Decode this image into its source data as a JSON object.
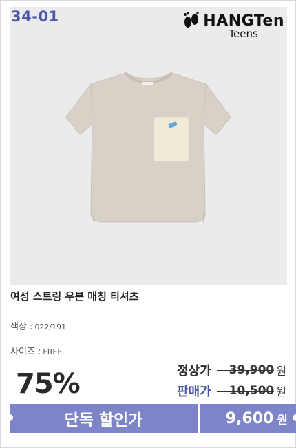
{
  "product": {
    "code": "34-01",
    "brand_name": "HANGTen",
    "brand_sub": "Teens",
    "title": "여성 스트링 우븐 매칭 티셔츠",
    "color_label": "색상 :",
    "color_value": "022/191",
    "size_label": "사이즈 :",
    "size_value": "FREE."
  },
  "pricing": {
    "discount": "75%",
    "regular_label": "정상가",
    "regular_price": "39,900",
    "sale_label": "판매가",
    "sale_price": "10,500",
    "won": "원",
    "exclusive_label": "단독 할인가",
    "exclusive_price": "9,600",
    "regular_label_color": "#333333",
    "sale_label_color": "#4a57a8",
    "bar_color": "#7e84c8"
  },
  "icons": {
    "brand_logo": "footprints-icon",
    "product_image": "tshirt-image"
  }
}
